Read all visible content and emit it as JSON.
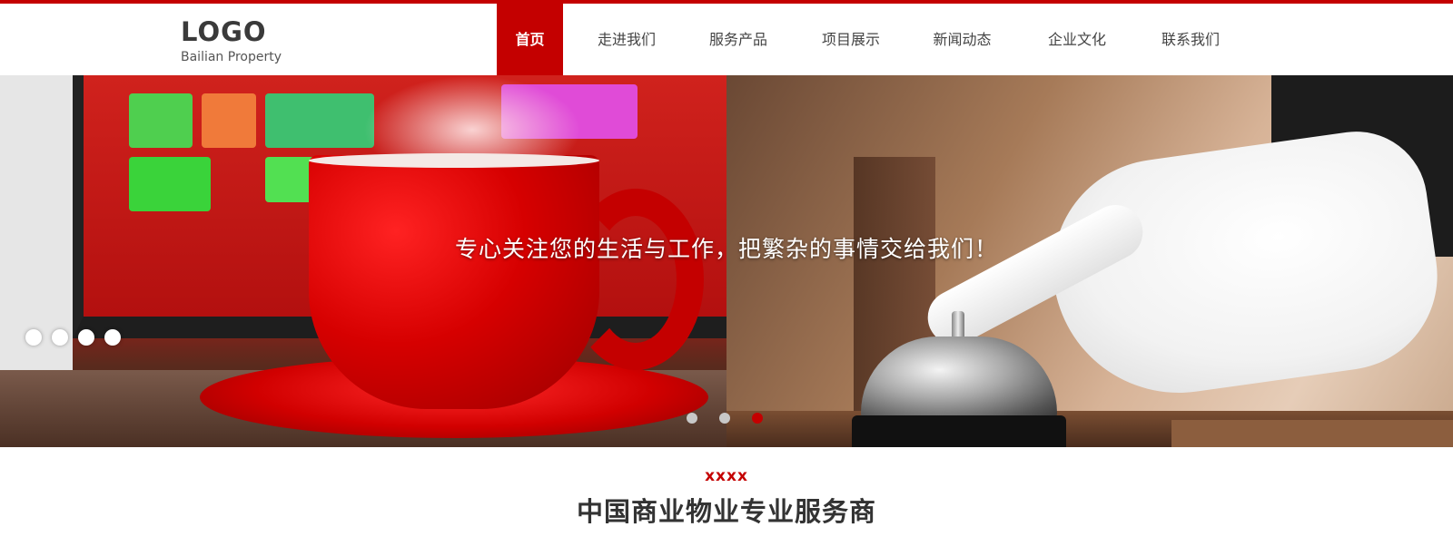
{
  "header": {
    "logo_main": "LOGO",
    "logo_sub": "Bailian Property",
    "nav": [
      {
        "label": "首页"
      },
      {
        "label": "走进我们"
      },
      {
        "label": "服务产品"
      },
      {
        "label": "项目展示"
      },
      {
        "label": "新闻动态"
      },
      {
        "label": "企业文化"
      },
      {
        "label": "联系我们"
      }
    ],
    "active_nav": "首页"
  },
  "banner": {
    "tagline": "专心关注您的生活与工作，把繁杂的事情交给我们！",
    "slide_count": 3,
    "active_slide": 3,
    "left_indicator_count": 4
  },
  "section": {
    "kicker": "xxxx",
    "title": "中国商业物业专业服务商"
  },
  "colors": {
    "accent": "#c40000",
    "text": "#333333",
    "nav_text": "#444444"
  }
}
